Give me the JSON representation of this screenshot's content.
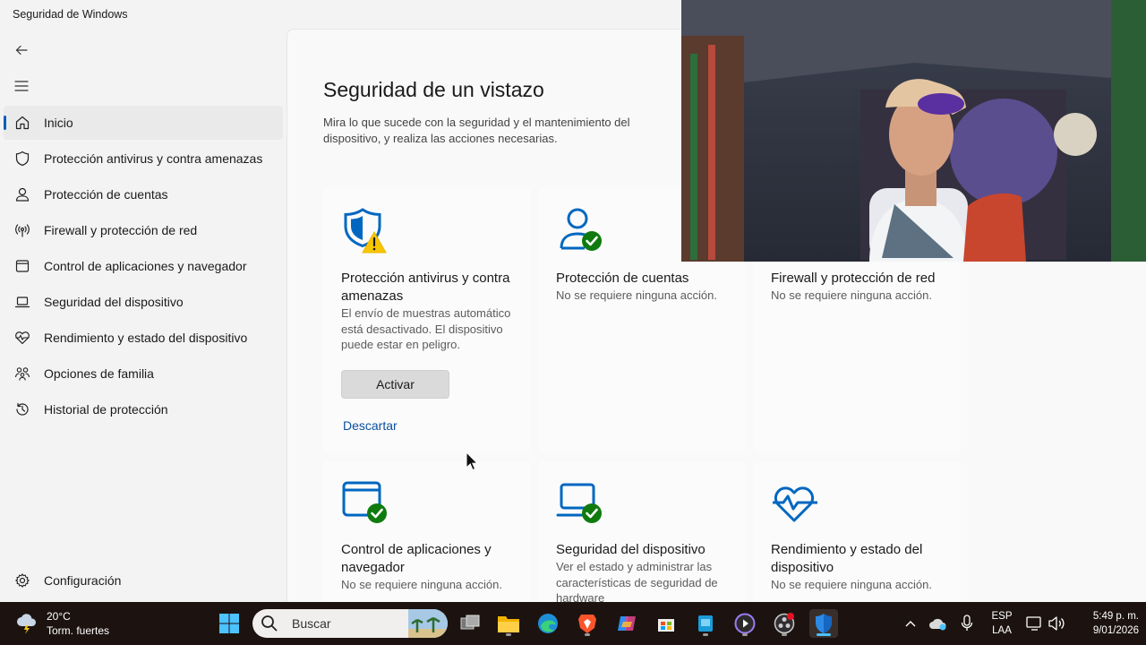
{
  "window": {
    "title": "Seguridad de Windows"
  },
  "nav": {
    "items": [
      {
        "label": "Inicio",
        "icon": "home-icon",
        "active": true
      },
      {
        "label": "Protección antivirus y contra amenazas",
        "icon": "shield-icon"
      },
      {
        "label": "Protección de cuentas",
        "icon": "person-icon"
      },
      {
        "label": "Firewall y protección de red",
        "icon": "wifi-antenna-icon"
      },
      {
        "label": "Control de aplicaciones y navegador",
        "icon": "browser-window-icon"
      },
      {
        "label": "Seguridad del dispositivo",
        "icon": "laptop-icon"
      },
      {
        "label": "Rendimiento y estado del dispositivo",
        "icon": "heart-pulse-icon"
      },
      {
        "label": "Opciones de familia",
        "icon": "family-icon"
      },
      {
        "label": "Historial de protección",
        "icon": "history-icon"
      }
    ],
    "settings": "Configuración"
  },
  "main": {
    "title": "Seguridad de un vistazo",
    "description": "Mira lo que sucede con la seguridad y el mantenimiento del dispositivo, y realiza las acciones necesarias.",
    "cards": [
      {
        "title": "Protección antivirus y contra amenazas",
        "description": "El envío de muestras automático está desactivado. El dispositivo puede estar en peligro.",
        "button": "Activar",
        "link": "Descartar",
        "status": "warning"
      },
      {
        "title": "Protección de cuentas",
        "description": "No se requiere ninguna acción.",
        "status": "ok"
      },
      {
        "title": "Firewall y protección de red",
        "description": "No se requiere ninguna acción.",
        "status": "ok"
      },
      {
        "title": "Control de aplicaciones y navegador",
        "description": "No se requiere ninguna acción.",
        "status": "ok"
      },
      {
        "title": "Seguridad del dispositivo",
        "description": "Ver el estado y administrar las características de seguridad de hardware",
        "status": "ok"
      },
      {
        "title": "Rendimiento y estado del dispositivo",
        "description": "No se requiere ninguna acción.",
        "status": "ok"
      }
    ]
  },
  "taskbar": {
    "weather": {
      "temp": "20°C",
      "condition": "Torm. fuertes"
    },
    "search_placeholder": "Buscar",
    "language": {
      "line1": "ESP",
      "line2": "LAA"
    },
    "clock": {
      "time": "5:49 p. m.",
      "date": "9/01/2026"
    }
  },
  "colors": {
    "accent": "#005fb8",
    "shield_blue": "#0067c0",
    "ok_green": "#0f7b0f",
    "warning_yellow": "#f7c600"
  }
}
